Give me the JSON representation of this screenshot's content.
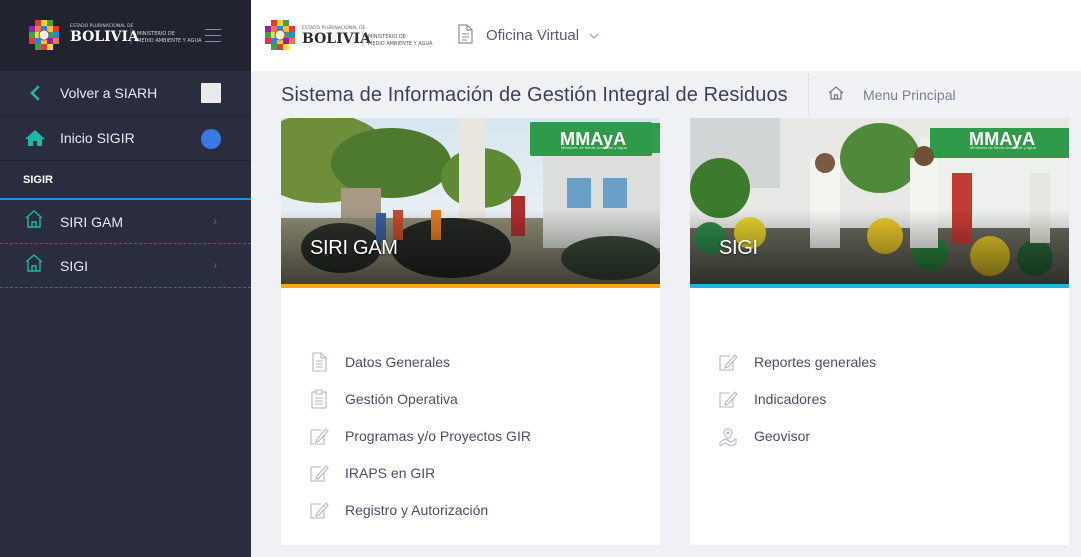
{
  "brand": {
    "country": "BOLIVIA",
    "state_line": "ESTADO PLURINACIONAL DE",
    "ministry_line1": "MINISTERIO DE",
    "ministry_line2": "MEDIO AMBIENTE Y AGUA"
  },
  "sidebar": {
    "back_label": "Volver a SIARH",
    "home_label": "Inicio SIGIR",
    "section_label": "SIGIR",
    "items": [
      {
        "label": "SIRI GAM"
      },
      {
        "label": "SIGI"
      }
    ]
  },
  "topbar": {
    "app_label": "Oficina Virtual"
  },
  "page": {
    "title": "Sistema de Información de Gestión Integral de Residuos",
    "breadcrumb": "Menu Principal"
  },
  "cards": [
    {
      "title": "SIRI GAM",
      "accent": "#f7a51c",
      "items": [
        {
          "label": "Datos Generales",
          "icon": "document-icon"
        },
        {
          "label": "Gestión Operativa",
          "icon": "clipboard-icon"
        },
        {
          "label": "Programas y/o Proyectos GIR",
          "icon": "edit-icon"
        },
        {
          "label": "IRAPS en GIR",
          "icon": "edit-icon"
        },
        {
          "label": "Registro y Autorización",
          "icon": "edit-icon"
        }
      ]
    },
    {
      "title": "SIGI",
      "accent": "#1eb5d8",
      "items": [
        {
          "label": "Reportes generales",
          "icon": "edit-icon"
        },
        {
          "label": "Indicadores",
          "icon": "edit-icon"
        },
        {
          "label": "Geovisor",
          "icon": "map-icon"
        }
      ]
    }
  ],
  "mmaya": {
    "name": "MMAyA",
    "sub": "Ministerio de Medio Ambiente y Agua"
  },
  "colors": {
    "sidebar_bg": "#2a2d3d",
    "sidebar_logo_bg": "#212331",
    "accent_teal": "#1fb7a6",
    "accent_blue": "#2b8ad6"
  }
}
